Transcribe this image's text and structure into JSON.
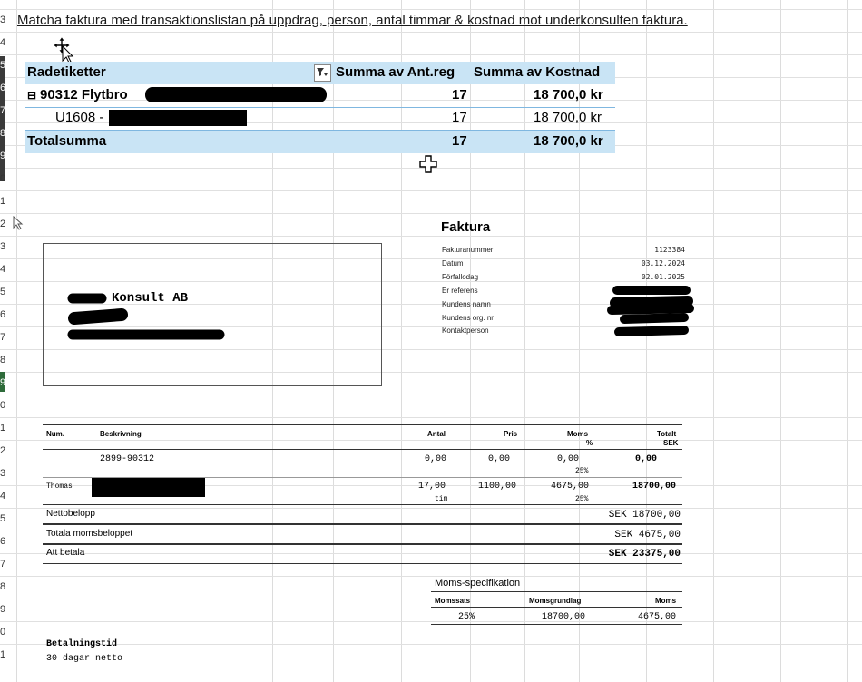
{
  "sheet": {
    "row_numbers": [
      "3",
      "4",
      "5",
      "6",
      "7",
      "8",
      "9",
      "0",
      "1",
      "2",
      "3",
      "4",
      "5",
      "6",
      "7",
      "8",
      "9",
      "0",
      "1",
      "2",
      "3",
      "4",
      "5",
      "6",
      "7",
      "8",
      "9",
      "0",
      "1"
    ],
    "heading": "Matcha faktura med transaktionslistan på uppdrag, person, antal timmar & kostnad mot underkonsulten faktura."
  },
  "pivot": {
    "headers": {
      "row_labels": "Radetiketter",
      "sum_hours": "Summa av Ant.reg",
      "sum_cost": "Summa av Kostnad"
    },
    "group": {
      "toggle": "⊟",
      "label": "90312   Flytbro",
      "hours": "17",
      "cost": "18 700,0 kr"
    },
    "item": {
      "label": "U1608 -",
      "hours": "17",
      "cost": "18 700,0 kr"
    },
    "total": {
      "label": "Totalsumma",
      "hours": "17",
      "cost": "18 700,0 kr"
    }
  },
  "invoice": {
    "title": "Faktura",
    "meta": [
      {
        "label": "Fakturanummer",
        "value": "1123384"
      },
      {
        "label": "Datum",
        "value": "03.12.2024"
      },
      {
        "label": "Förfallodag",
        "value": "02.01.2025"
      },
      {
        "label": "Er referens",
        "value": ""
      },
      {
        "label": "Kundens namn",
        "value": ""
      },
      {
        "label": "Kundens org. nr",
        "value": ""
      },
      {
        "label": "Kontaktperson",
        "value": ""
      }
    ],
    "sender_name": "Konsult AB",
    "columns": {
      "num": "Num.",
      "desc": "Beskrivning",
      "qty": "Antal",
      "price": "Pris",
      "vat": "Moms",
      "vat_pct": "%",
      "total": "Totalt",
      "total_cur": "SEK"
    },
    "rows": [
      {
        "num": "",
        "desc": "2899-90312",
        "qty": "0,00",
        "unit": "",
        "price": "0,00",
        "vat": "0,00",
        "vat_rate": "25%",
        "total": "0,00"
      },
      {
        "num": "Thomas",
        "desc": "",
        "qty": "17,00",
        "unit": "tim",
        "price": "1100,00",
        "vat": "4675,00",
        "vat_rate": "25%",
        "total": "18700,00"
      }
    ],
    "summary": [
      {
        "label": "Nettobelopp",
        "value": "SEK 18700,00"
      },
      {
        "label": "Totala momsbeloppet",
        "value": "SEK 4675,00"
      },
      {
        "label": "Att betala",
        "value": "SEK 23375,00"
      }
    ],
    "vat_spec": {
      "title": "Moms-specifikation",
      "headers": {
        "rate": "Momssats",
        "base": "Momsgrundlag",
        "vat": "Moms"
      },
      "row": {
        "rate": "25%",
        "base": "18700,00",
        "vat": "4675,00"
      }
    },
    "payment": {
      "title": "Betalningstid",
      "value": "30 dagar netto"
    }
  }
}
